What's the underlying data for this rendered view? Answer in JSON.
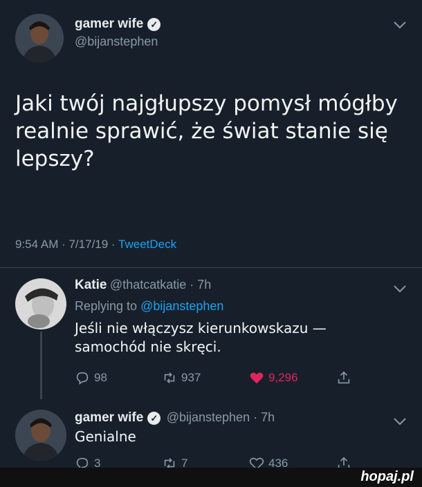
{
  "main_tweet": {
    "display_name": "gamer wife",
    "handle": "@bijanstephen",
    "text": "Jaki twój najgłupszy pomysł mógłby realnie sprawić, że świat stanie się lepszy?",
    "time": "9:54 AM · 7/17/19 ·",
    "source": "TweetDeck",
    "verified_icon": "check-badge-icon"
  },
  "reply_1": {
    "display_name": "Katie",
    "handle": "@thatcatkatie · 7h",
    "replying_prefix": "Replying to",
    "replying_to": "@bijanstephen",
    "text": "Jeśli nie włączysz kierunkowskazu — samochód nie skręci.",
    "replies": "98",
    "retweets": "937",
    "likes": "9,296"
  },
  "reply_2": {
    "display_name": "gamer wife",
    "handle": "@bijanstephen · 7h",
    "text": "Genialne",
    "replies": "3",
    "retweets": "7",
    "likes": "436"
  },
  "watermark": "hopaj.pl",
  "colors": {
    "background": "#17202a",
    "accent": "#1da1f2",
    "like": "#e0245e",
    "muted": "#8899a6"
  }
}
